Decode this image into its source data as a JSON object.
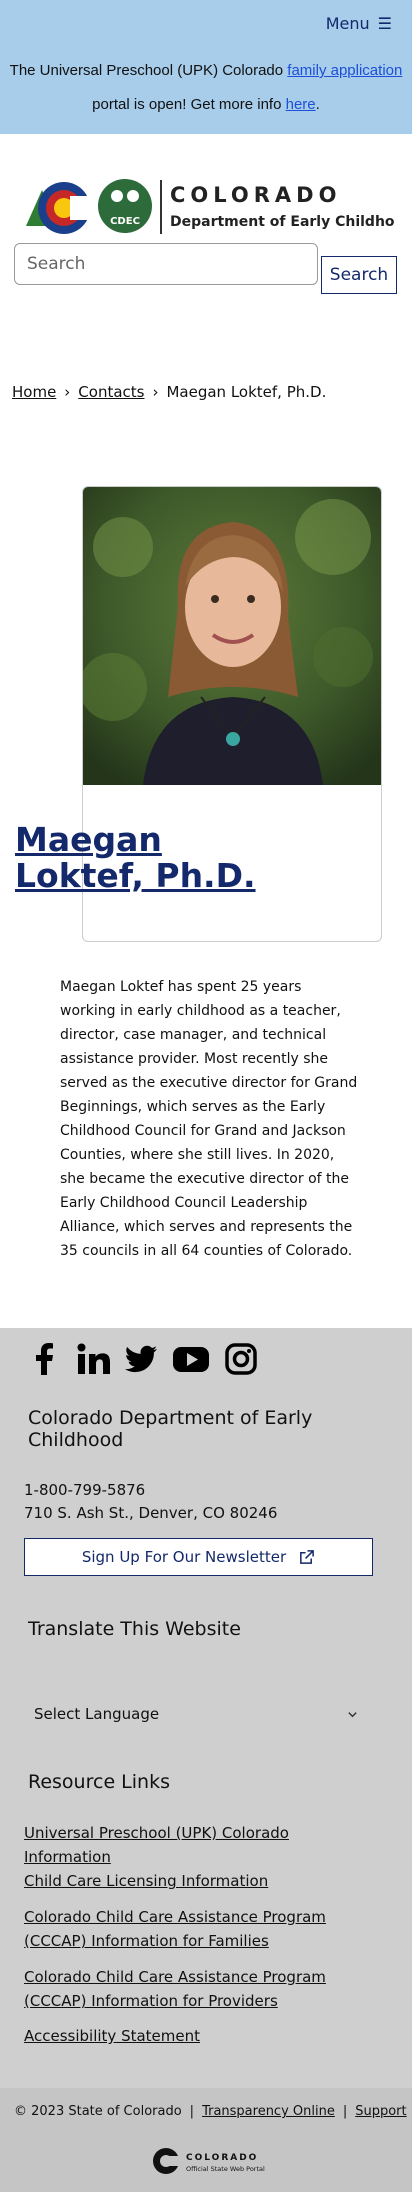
{
  "header": {
    "menu_label": "Menu",
    "alert_part1": "The Universal Preschool (UPK) Colorado",
    "alert_link1": "family application",
    "alert_part2": "portal is open! Get more info",
    "alert_link2": "here",
    "alert_end": "."
  },
  "logo": {
    "title": "COLORADO",
    "subtitle": "Department of Early Childhood",
    "badge": "CDEC"
  },
  "search": {
    "placeholder": "Search",
    "button_label": "Search"
  },
  "breadcrumb": {
    "home": "Home",
    "contacts": "Contacts",
    "current": "Maegan Loktef, Ph.D."
  },
  "profile": {
    "name": "Maegan Loktef, Ph.D.",
    "bio": "Maegan Loktef has spent 25 years working in early childhood as a teacher, director, case manager, and technical assistance provider. Most recently she served as the executive director for Grand Beginnings, which serves as the Early Childhood Council for Grand and Jackson Counties, where she still lives. In 2020, she became the executive director of the Early Childhood Council Leadership Alliance, which serves and represents the 35 councils in all 64 counties of Colorado."
  },
  "footer": {
    "social_icons": [
      "facebook-icon",
      "linkedin-icon",
      "twitter-icon",
      "youtube-icon",
      "instagram-icon"
    ],
    "org_name": "Colorado Department of Early Childhood",
    "phone": "1-800-799-5876",
    "address": "710 S. Ash St., Denver, CO 80246",
    "newsletter_label": "Sign Up For Our Newsletter",
    "translate_heading": "Translate This Website",
    "language_select": "Select Language",
    "resources_heading": "Resource Links",
    "resource_links": [
      "Universal Preschool (UPK) Colorado Information",
      "Child Care Licensing Information",
      "Colorado Child Care Assistance Program (CCCAP) Information for Families",
      "Colorado Child Care Assistance Program (CCCAP) Information for Providers",
      "Accessibility Statement"
    ],
    "copyright": "© 2023 State of Colorado",
    "transparency": "Transparency Online",
    "support": "Support",
    "state_logo_title": "COLORADO",
    "state_logo_sub": "Official State Web Portal"
  },
  "colors": {
    "banner": "#a7cdeb",
    "brand_navy": "#14296b",
    "footer_bg": "#cfcfcf"
  }
}
